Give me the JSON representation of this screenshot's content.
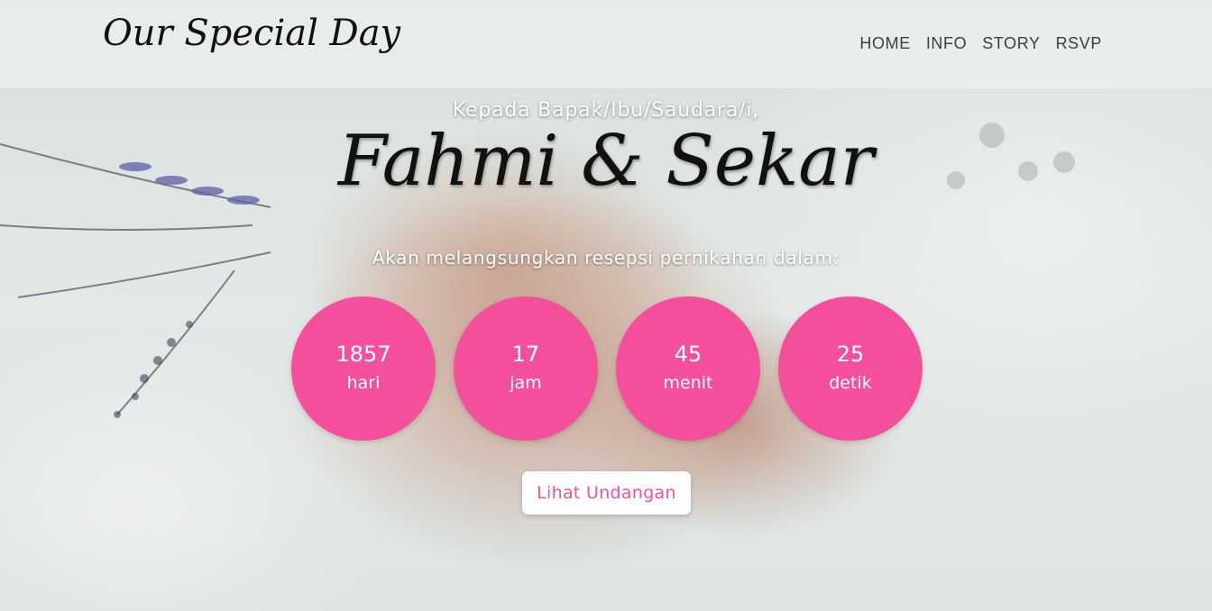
{
  "navbar": {
    "brand": "Our Special Day",
    "items": [
      {
        "label": "HOME"
      },
      {
        "label": "INFO"
      },
      {
        "label": "STORY"
      },
      {
        "label": "RSVP"
      }
    ]
  },
  "hero": {
    "greeting": "Kepada Bapak/Ibu/Saudara/i,",
    "couple": "Fahmi & Sekar",
    "subtitle": "Akan melangsungkan resepsi pernikahan dalam:",
    "countdown": [
      {
        "value": "1857",
        "unit": "hari"
      },
      {
        "value": "17",
        "unit": "jam"
      },
      {
        "value": "45",
        "unit": "menit"
      },
      {
        "value": "25",
        "unit": "detik"
      }
    ],
    "cta_label": "Lihat Undangan"
  },
  "colors": {
    "accent": "#f34f9b",
    "navbar_bg": "#ecf0ee",
    "nav_text": "#3d3f3e"
  }
}
